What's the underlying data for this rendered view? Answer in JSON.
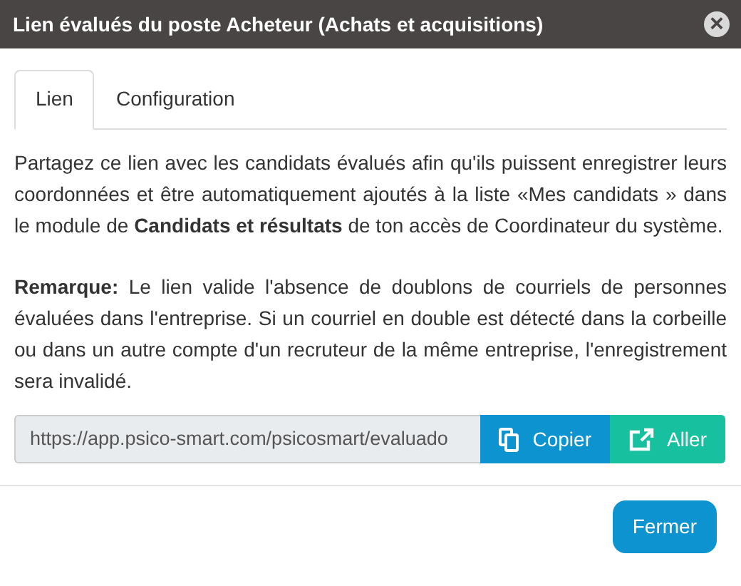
{
  "window": {
    "title": "Lien évalués du poste Acheteur (Achats et acquisitions)",
    "close": "×"
  },
  "tabs": [
    {
      "label": "Lien",
      "selected": true
    },
    {
      "label": "Configuration",
      "selected": false
    }
  ],
  "paragraphs": [
    "Partagez ce lien avec les candidats évalués afin qu'ils puissent enregistrer leurs coordonnées et être automatiquement ajoutés à la liste «Mes candidats » dans le module de **Candidats et résultats** de ton accès de Coordinateur du système.",
    "**Remarque:** Le lien valide l'absence de doublons de courriels de personnes évaluées dans l'entreprise. Si un courriel en double est détecté dans la corbeille ou dans un autre compte d'un recruteur de la même entreprise, l'enregistrement sera invalidé."
  ],
  "link": {
    "value": "https://app.psico-smart.com/psicosmart/evaluado"
  },
  "link_buttons": [
    {
      "kind": "copy",
      "label": "Copier"
    },
    {
      "kind": "open",
      "label": "Aller"
    }
  ],
  "footer_button": "Fermer"
}
